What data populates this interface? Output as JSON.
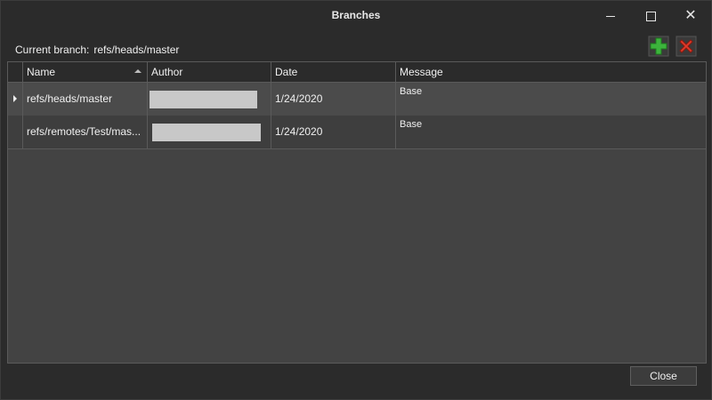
{
  "window": {
    "title": "Branches",
    "buttons": {
      "minimize": "minimize",
      "maximize": "maximize",
      "close": "✕"
    }
  },
  "current_branch": {
    "label": "Current branch:",
    "value": "refs/heads/master"
  },
  "actions": {
    "add_icon": "add-icon",
    "delete_icon": "delete-icon",
    "colors": {
      "add": "#3cb43c",
      "delete": "#e03a2a"
    }
  },
  "table": {
    "columns": [
      "Name",
      "Author",
      "Date",
      "Message"
    ],
    "sort_column": "Name",
    "rows": [
      {
        "name": "refs/heads/master",
        "author": "",
        "date": "1/24/2020",
        "message": "Base",
        "selected": true
      },
      {
        "name": "refs/remotes/Test/mas...",
        "author": "",
        "date": "1/24/2020",
        "message": "Base",
        "selected": false
      }
    ]
  },
  "footer": {
    "close_label": "Close"
  }
}
